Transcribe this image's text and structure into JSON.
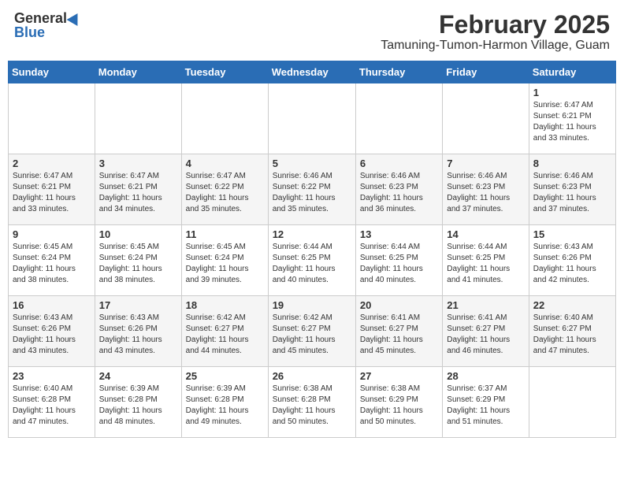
{
  "header": {
    "logo_general": "General",
    "logo_blue": "Blue",
    "month_year": "February 2025",
    "location": "Tamuning-Tumon-Harmon Village, Guam"
  },
  "weekdays": [
    "Sunday",
    "Monday",
    "Tuesday",
    "Wednesday",
    "Thursday",
    "Friday",
    "Saturday"
  ],
  "weeks": [
    [
      {
        "day": "",
        "info": ""
      },
      {
        "day": "",
        "info": ""
      },
      {
        "day": "",
        "info": ""
      },
      {
        "day": "",
        "info": ""
      },
      {
        "day": "",
        "info": ""
      },
      {
        "day": "",
        "info": ""
      },
      {
        "day": "1",
        "info": "Sunrise: 6:47 AM\nSunset: 6:21 PM\nDaylight: 11 hours\nand 33 minutes."
      }
    ],
    [
      {
        "day": "2",
        "info": "Sunrise: 6:47 AM\nSunset: 6:21 PM\nDaylight: 11 hours\nand 33 minutes."
      },
      {
        "day": "3",
        "info": "Sunrise: 6:47 AM\nSunset: 6:21 PM\nDaylight: 11 hours\nand 34 minutes."
      },
      {
        "day": "4",
        "info": "Sunrise: 6:47 AM\nSunset: 6:22 PM\nDaylight: 11 hours\nand 35 minutes."
      },
      {
        "day": "5",
        "info": "Sunrise: 6:46 AM\nSunset: 6:22 PM\nDaylight: 11 hours\nand 35 minutes."
      },
      {
        "day": "6",
        "info": "Sunrise: 6:46 AM\nSunset: 6:23 PM\nDaylight: 11 hours\nand 36 minutes."
      },
      {
        "day": "7",
        "info": "Sunrise: 6:46 AM\nSunset: 6:23 PM\nDaylight: 11 hours\nand 37 minutes."
      },
      {
        "day": "8",
        "info": "Sunrise: 6:46 AM\nSunset: 6:23 PM\nDaylight: 11 hours\nand 37 minutes."
      }
    ],
    [
      {
        "day": "9",
        "info": "Sunrise: 6:45 AM\nSunset: 6:24 PM\nDaylight: 11 hours\nand 38 minutes."
      },
      {
        "day": "10",
        "info": "Sunrise: 6:45 AM\nSunset: 6:24 PM\nDaylight: 11 hours\nand 38 minutes."
      },
      {
        "day": "11",
        "info": "Sunrise: 6:45 AM\nSunset: 6:24 PM\nDaylight: 11 hours\nand 39 minutes."
      },
      {
        "day": "12",
        "info": "Sunrise: 6:44 AM\nSunset: 6:25 PM\nDaylight: 11 hours\nand 40 minutes."
      },
      {
        "day": "13",
        "info": "Sunrise: 6:44 AM\nSunset: 6:25 PM\nDaylight: 11 hours\nand 40 minutes."
      },
      {
        "day": "14",
        "info": "Sunrise: 6:44 AM\nSunset: 6:25 PM\nDaylight: 11 hours\nand 41 minutes."
      },
      {
        "day": "15",
        "info": "Sunrise: 6:43 AM\nSunset: 6:26 PM\nDaylight: 11 hours\nand 42 minutes."
      }
    ],
    [
      {
        "day": "16",
        "info": "Sunrise: 6:43 AM\nSunset: 6:26 PM\nDaylight: 11 hours\nand 43 minutes."
      },
      {
        "day": "17",
        "info": "Sunrise: 6:43 AM\nSunset: 6:26 PM\nDaylight: 11 hours\nand 43 minutes."
      },
      {
        "day": "18",
        "info": "Sunrise: 6:42 AM\nSunset: 6:27 PM\nDaylight: 11 hours\nand 44 minutes."
      },
      {
        "day": "19",
        "info": "Sunrise: 6:42 AM\nSunset: 6:27 PM\nDaylight: 11 hours\nand 45 minutes."
      },
      {
        "day": "20",
        "info": "Sunrise: 6:41 AM\nSunset: 6:27 PM\nDaylight: 11 hours\nand 45 minutes."
      },
      {
        "day": "21",
        "info": "Sunrise: 6:41 AM\nSunset: 6:27 PM\nDaylight: 11 hours\nand 46 minutes."
      },
      {
        "day": "22",
        "info": "Sunrise: 6:40 AM\nSunset: 6:27 PM\nDaylight: 11 hours\nand 47 minutes."
      }
    ],
    [
      {
        "day": "23",
        "info": "Sunrise: 6:40 AM\nSunset: 6:28 PM\nDaylight: 11 hours\nand 47 minutes."
      },
      {
        "day": "24",
        "info": "Sunrise: 6:39 AM\nSunset: 6:28 PM\nDaylight: 11 hours\nand 48 minutes."
      },
      {
        "day": "25",
        "info": "Sunrise: 6:39 AM\nSunset: 6:28 PM\nDaylight: 11 hours\nand 49 minutes."
      },
      {
        "day": "26",
        "info": "Sunrise: 6:38 AM\nSunset: 6:28 PM\nDaylight: 11 hours\nand 50 minutes."
      },
      {
        "day": "27",
        "info": "Sunrise: 6:38 AM\nSunset: 6:29 PM\nDaylight: 11 hours\nand 50 minutes."
      },
      {
        "day": "28",
        "info": "Sunrise: 6:37 AM\nSunset: 6:29 PM\nDaylight: 11 hours\nand 51 minutes."
      },
      {
        "day": "",
        "info": ""
      }
    ]
  ]
}
